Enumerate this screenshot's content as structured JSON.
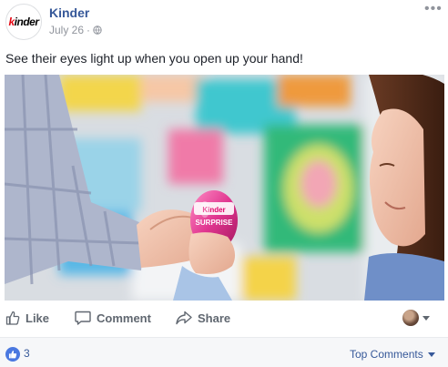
{
  "post": {
    "page_name": "Kinder",
    "date": "July 26",
    "separator": "·",
    "caption": "See their eyes light up when you open up your hand!",
    "logo_text_k": "k",
    "logo_text_rest": "inder",
    "image_alt": "A hand offering a pink Kinder Surprise egg to a smiling child",
    "egg_label": "Kinder SURPRISE"
  },
  "actions": {
    "like_label": "Like",
    "comment_label": "Comment",
    "share_label": "Share"
  },
  "footer": {
    "like_count": "3",
    "sort_label": "Top Comments"
  },
  "icons": {
    "globe": "globe-icon",
    "more": "more-options-icon",
    "like": "thumbs-up-icon",
    "comment": "speech-bubble-icon",
    "share": "share-arrow-icon",
    "caret": "caret-down-icon",
    "reaction": "like-reaction-icon"
  },
  "colors": {
    "link_blue": "#365899",
    "muted_gray": "#90949c",
    "action_gray": "#606770",
    "like_blue": "#4a78e0",
    "footer_bg": "#f6f7f9"
  }
}
